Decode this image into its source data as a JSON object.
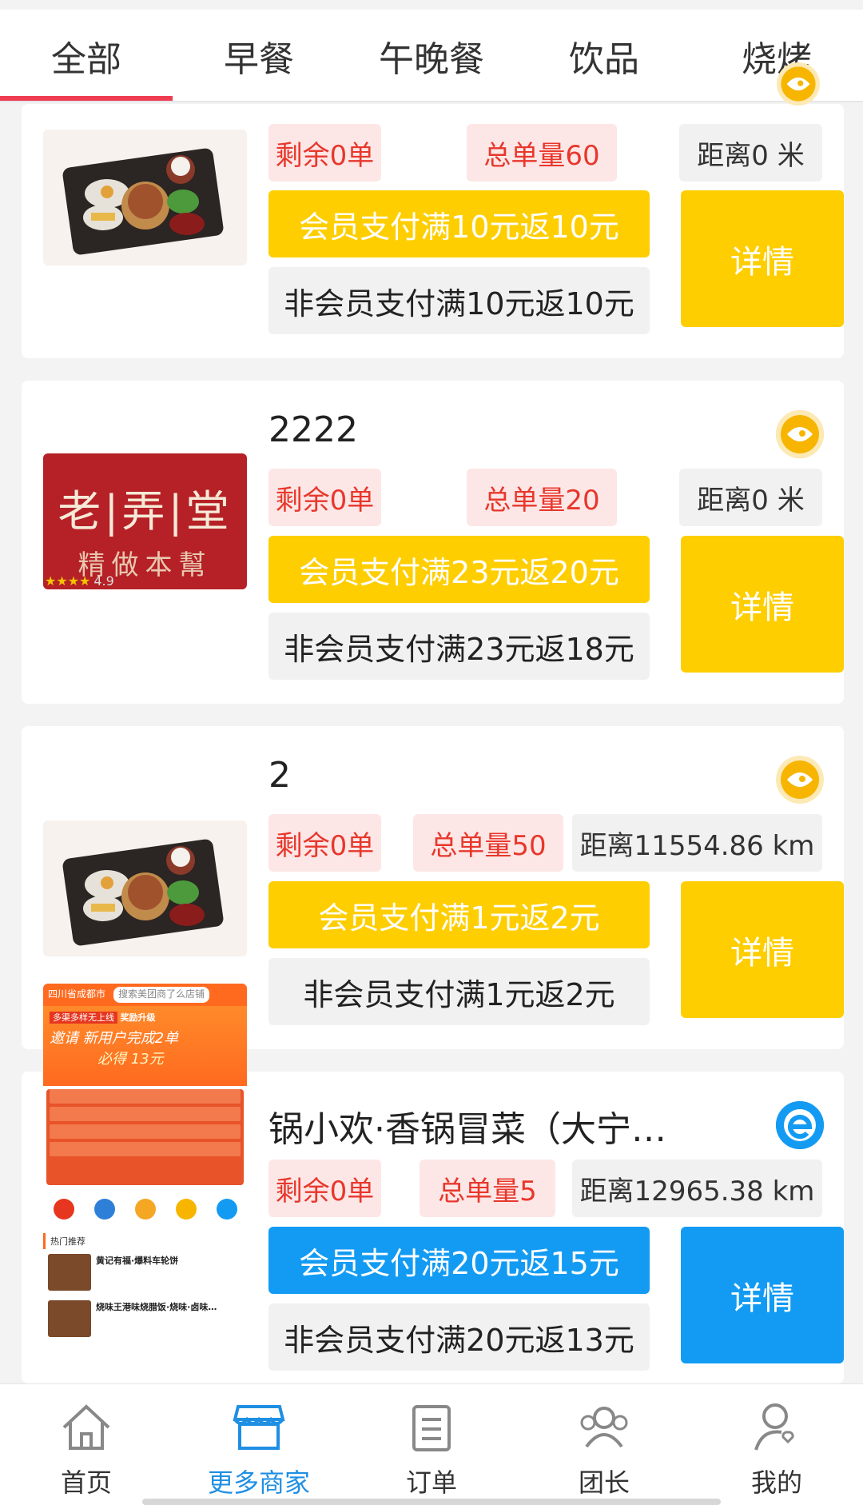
{
  "tabs": [
    "全部",
    "早餐",
    "午晚餐",
    "饮品",
    "烧烤"
  ],
  "active_tab": 0,
  "cards": [
    {
      "name": "",
      "remaining": "剩余0单",
      "total": "总单量60",
      "distance": "距离0 米",
      "member_promo": "会员支付满10元返10元",
      "nonmember_promo": "非会员支付满10元返10元",
      "detail": "详情",
      "promo_color": "yellow"
    },
    {
      "name": "2222",
      "remaining": "剩余0单",
      "total": "总单量20",
      "distance": "距离0 米",
      "member_promo": "会员支付满23元返20元",
      "nonmember_promo": "非会员支付满23元返18元",
      "detail": "详情",
      "promo_color": "yellow",
      "logo_text": "老|弄|堂",
      "logo_sub": "精做本幫",
      "rating": "4.9"
    },
    {
      "name": "2",
      "remaining": "剩余0单",
      "total": "总单量50",
      "distance": "距离11554.86 km",
      "member_promo": "会员支付满1元返2元",
      "nonmember_promo": "非会员支付满1元返2元",
      "detail": "详情",
      "promo_color": "yellow"
    },
    {
      "name": "锅小欢·香锅冒菜（大宁…",
      "remaining": "剩余0单",
      "total": "总单量5",
      "distance": "距离12965.38 km",
      "member_promo": "会员支付满20元返15元",
      "nonmember_promo": "非会员支付满20元返13元",
      "detail": "详情",
      "promo_color": "blue"
    }
  ],
  "promo_poster": {
    "header": "四川省成都市",
    "search": "搜索美团商了么店铺",
    "badge": "多渠多样无上线",
    "title": "奖励升级",
    "line1": "邀请 新用户完成2单",
    "line2": "必得 13元",
    "section": "热门推荐",
    "item1": "黄记有福·爆料车轮饼",
    "item2": "烧味王港味烧腊饭·烧味·卤味…"
  },
  "bottom_nav": [
    {
      "label": "首页",
      "icon": "home-icon"
    },
    {
      "label": "更多商家",
      "icon": "store-icon"
    },
    {
      "label": "订单",
      "icon": "order-icon"
    },
    {
      "label": "团长",
      "icon": "group-icon"
    },
    {
      "label": "我的",
      "icon": "profile-icon"
    }
  ],
  "active_nav": 1,
  "colors": {
    "accent_red": "#ee3d52",
    "tag_red_text": "#e8372c",
    "tag_red_bg": "#fde7e6",
    "yellow": "#fece00",
    "blue": "#139bf3",
    "nav_active": "#1f8fe3"
  }
}
